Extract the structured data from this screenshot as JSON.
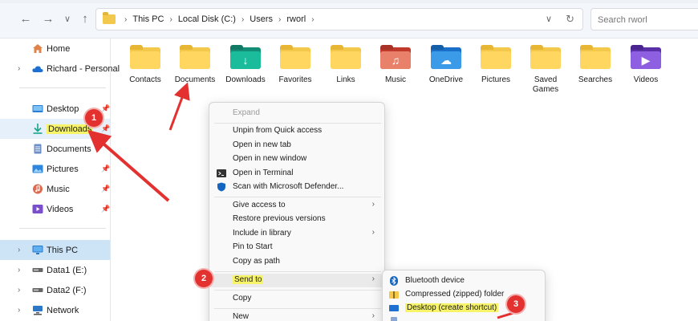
{
  "address_bar": {
    "breadcrumbs": [
      "This PC",
      "Local Disk (C:)",
      "Users",
      "rworl"
    ],
    "search_placeholder": "Search rworl"
  },
  "sidebar": {
    "items": [
      {
        "label": "Home",
        "icon": "home-icon"
      },
      {
        "label": "Richard - Personal",
        "icon": "onedrive-cloud-icon"
      },
      {
        "label": "Desktop",
        "icon": "desktop-icon"
      },
      {
        "label": "Downloads",
        "icon": "download-arrow-icon"
      },
      {
        "label": "Documents",
        "icon": "document-icon"
      },
      {
        "label": "Pictures",
        "icon": "pictures-icon"
      },
      {
        "label": "Music",
        "icon": "music-icon"
      },
      {
        "label": "Videos",
        "icon": "videos-icon"
      },
      {
        "label": "This PC",
        "icon": "monitor-icon"
      },
      {
        "label": "Data1 (E:)",
        "icon": "drive-icon"
      },
      {
        "label": "Data2 (F:)",
        "icon": "drive-icon"
      },
      {
        "label": "Network",
        "icon": "network-icon"
      }
    ]
  },
  "folders": [
    {
      "label": "Contacts"
    },
    {
      "label": "Documents"
    },
    {
      "label": "Downloads"
    },
    {
      "label": "Favorites"
    },
    {
      "label": "Links"
    },
    {
      "label": "Music"
    },
    {
      "label": "OneDrive"
    },
    {
      "label": "Pictures"
    },
    {
      "label": "Saved Games"
    },
    {
      "label": "Searches"
    },
    {
      "label": "Videos"
    }
  ],
  "context_menu": {
    "items": [
      {
        "label": "Expand"
      },
      {
        "label": "Unpin from Quick access"
      },
      {
        "label": "Open in new tab"
      },
      {
        "label": "Open in new window"
      },
      {
        "label": "Open in Terminal"
      },
      {
        "label": "Scan with Microsoft Defender..."
      },
      {
        "label": "Give access to"
      },
      {
        "label": "Restore previous versions"
      },
      {
        "label": "Include in library"
      },
      {
        "label": "Pin to Start"
      },
      {
        "label": "Copy as path"
      },
      {
        "label": "Send to"
      },
      {
        "label": "Copy"
      },
      {
        "label": "New"
      }
    ]
  },
  "send_to_menu": {
    "items": [
      {
        "label": "Bluetooth device"
      },
      {
        "label": "Compressed (zipped) folder"
      },
      {
        "label": "Desktop (create shortcut)"
      }
    ]
  },
  "annotations": {
    "badges": [
      "1",
      "2",
      "3"
    ],
    "highlight_color": "#f7f46a",
    "arrow_color": "#e2312f"
  },
  "colors": {
    "selected_bg": "#cde4f7",
    "folder_yellow": "#ffd660",
    "accent_blue": "#0a6ed1"
  }
}
